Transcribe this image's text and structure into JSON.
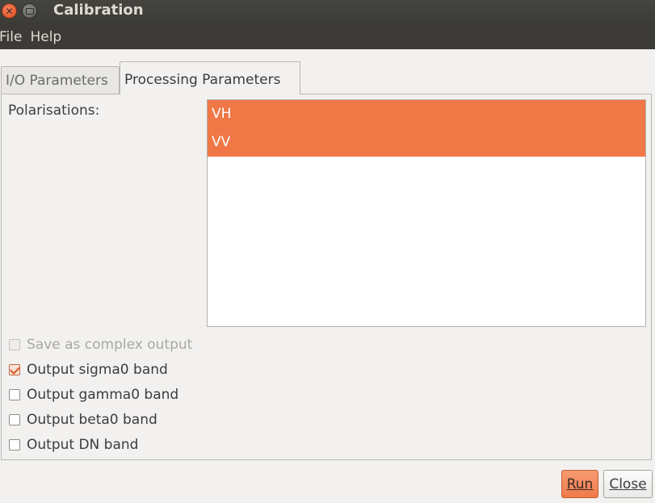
{
  "window": {
    "title": "Calibration"
  },
  "menu": {
    "items": [
      "File",
      "Help"
    ]
  },
  "tabs": [
    {
      "label": "I/O Parameters"
    },
    {
      "label": "Processing Parameters"
    }
  ],
  "panel": {
    "polarisations_label": "Polarisations:",
    "polarisations": [
      "VH",
      "VV"
    ],
    "options": [
      {
        "label": "Save as complex output",
        "checked": false,
        "enabled": false
      },
      {
        "label": "Output sigma0 band",
        "checked": true,
        "enabled": true
      },
      {
        "label": "Output gamma0 band",
        "checked": false,
        "enabled": true
      },
      {
        "label": "Output beta0 band",
        "checked": false,
        "enabled": true
      },
      {
        "label": "Output DN band",
        "checked": false,
        "enabled": true
      }
    ]
  },
  "buttons": {
    "run": "Run",
    "close": "Close"
  },
  "colors": {
    "accent": "#f07746",
    "titlebar": "#3c3b37"
  }
}
